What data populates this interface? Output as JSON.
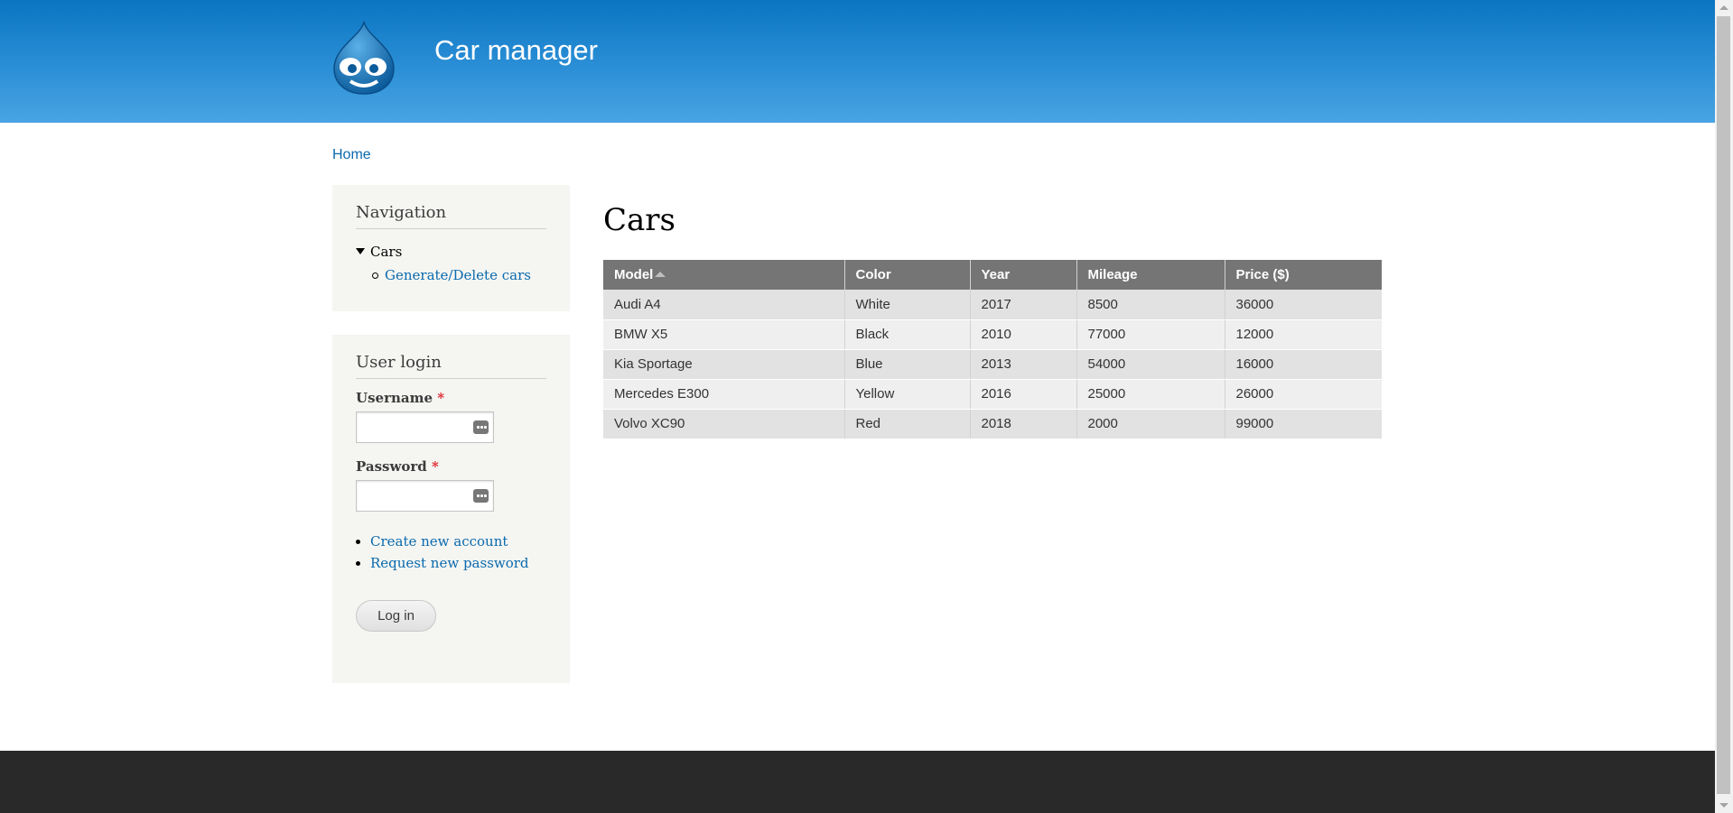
{
  "header": {
    "site_name": "Car manager",
    "logo_icon": "drupal-drop-icon"
  },
  "breadcrumb": {
    "home": "Home"
  },
  "navigation": {
    "title": "Navigation",
    "cars": "Cars",
    "sub_item": "Generate/Delete cars"
  },
  "login": {
    "title": "User login",
    "username_label": "Username",
    "password_label": "Password",
    "required_mark": "*",
    "username_value": "",
    "password_value": "",
    "create_account": "Create new account",
    "request_password": "Request new password",
    "button": "Log in"
  },
  "main": {
    "title": "Cars",
    "columns": [
      "Model",
      "Color",
      "Year",
      "Mileage",
      "Price ($)"
    ],
    "sorted_column": "Model",
    "rows": [
      [
        "Audi A4",
        "White",
        "2017",
        "8500",
        "36000"
      ],
      [
        "BMW X5",
        "Black",
        "2010",
        "77000",
        "12000"
      ],
      [
        "Kia Sportage",
        "Blue",
        "2013",
        "54000",
        "16000"
      ],
      [
        "Mercedes E300",
        "Yellow",
        "2016",
        "25000",
        "26000"
      ],
      [
        "Volvo XC90",
        "Red",
        "2018",
        "2000",
        "99000"
      ]
    ]
  },
  "colors": {
    "header_top": "#0a75c2",
    "header_bottom": "#48a4e3",
    "link": "#0a6aae",
    "table_header": "#757575",
    "footer": "#292929",
    "sidebar_bg": "#f5f5f2"
  }
}
